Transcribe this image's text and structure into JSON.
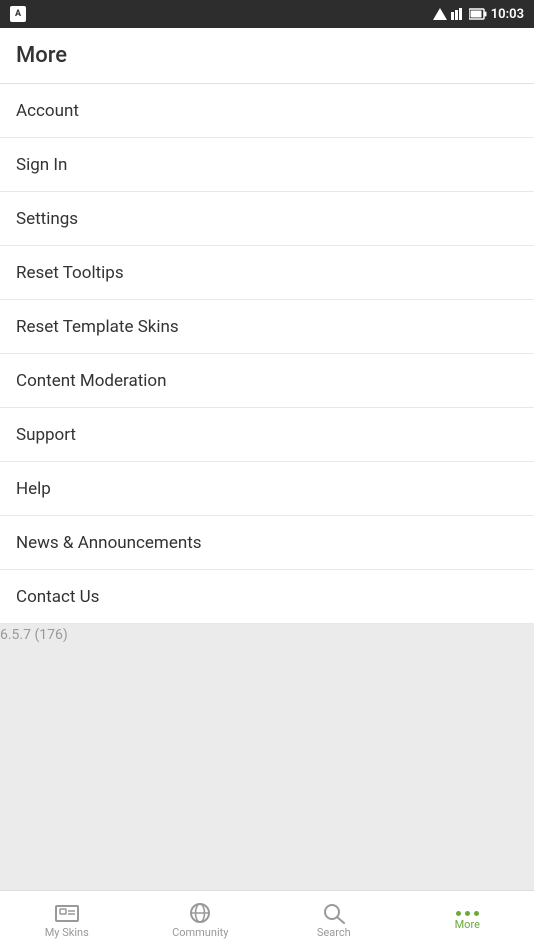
{
  "statusBar": {
    "time": "10:03",
    "appIcon": "A"
  },
  "header": {
    "title": "More"
  },
  "menuItems": [
    {
      "id": "account",
      "label": "Account"
    },
    {
      "id": "sign-in",
      "label": "Sign In"
    },
    {
      "id": "settings",
      "label": "Settings"
    },
    {
      "id": "reset-tooltips",
      "label": "Reset Tooltips"
    },
    {
      "id": "reset-template-skins",
      "label": "Reset Template Skins"
    },
    {
      "id": "content-moderation",
      "label": "Content Moderation"
    },
    {
      "id": "support",
      "label": "Support"
    },
    {
      "id": "help",
      "label": "Help"
    },
    {
      "id": "news-announcements",
      "label": "News & Announcements"
    },
    {
      "id": "contact-us",
      "label": "Contact Us"
    }
  ],
  "version": {
    "text": "6.5.7 (176)"
  },
  "bottomNav": {
    "items": [
      {
        "id": "my-skins",
        "label": "My Skins",
        "active": false
      },
      {
        "id": "community",
        "label": "Community",
        "active": false
      },
      {
        "id": "search",
        "label": "Search",
        "active": false
      },
      {
        "id": "more",
        "label": "More",
        "active": true
      }
    ]
  }
}
